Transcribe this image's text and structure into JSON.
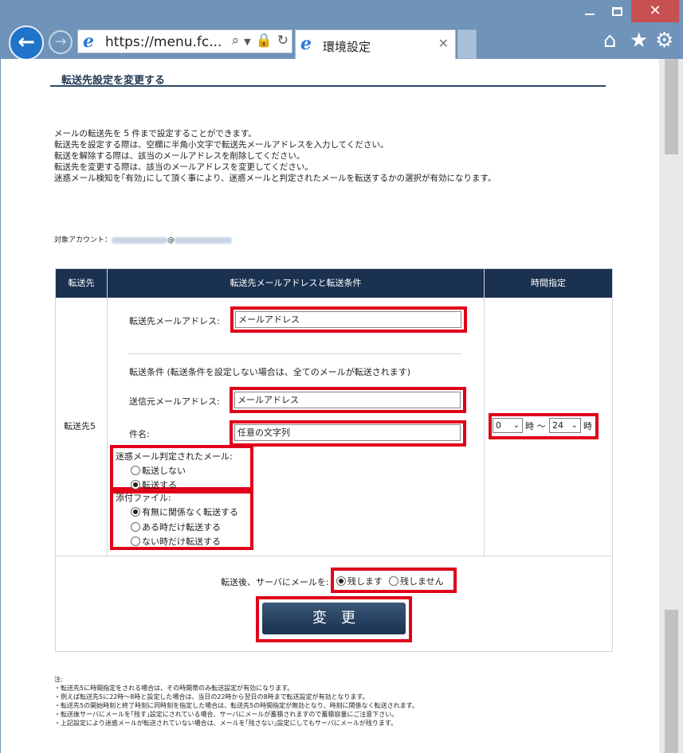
{
  "browser": {
    "url": "https://menu.fc...",
    "tab_title": "環境設定",
    "window_controls": [
      "minimize",
      "maximize",
      "close"
    ],
    "icons": [
      "back-icon",
      "forward-icon",
      "ie-logo-icon",
      "search-icon",
      "dropdown-icon",
      "lock-icon",
      "refresh-icon",
      "close-tab-icon",
      "home-icon",
      "favorites-star-icon",
      "settings-gear-icon"
    ]
  },
  "page": {
    "title": "転送先設定を変更する",
    "intro": [
      "メールの転送先を 5 件まで設定することができます。",
      "転送先を設定する際は、空欄に半角小文字で転送先メールアドレスを入力してください。",
      "転送を解除する際は、該当のメールアドレスを削除してください。",
      "転送先を変更する際は、該当のメールアドレスを変更してください。",
      "迷惑メール検知を｢有効｣にして頂く事により、迷惑メールと判定されたメールを転送するかの選択が有効になります。"
    ],
    "account_label": "対象アカウント："
  },
  "table": {
    "headers": [
      "転送先",
      "転送先メールアドレスと転送条件",
      "時間指定"
    ],
    "row_label": "転送先5",
    "forward_address_label": "転送先メールアドレス:",
    "forward_address_value": "メールアドレス",
    "conditions_label": "転送条件 (転送条件を設定しない場合は、全てのメールが転送されます)",
    "sender_label": "送信元メールアドレス:",
    "sender_value": "メールアドレス",
    "subject_label": "件名:",
    "subject_value": "任意の文字列",
    "spam_label": "迷惑メール判定されたメール:",
    "spam_options": [
      "転送しない",
      "転送する"
    ],
    "spam_selected": 1,
    "attach_label": "添付ファイル:",
    "attach_options": [
      "有無に関係なく転送する",
      "ある時だけ転送する",
      "ない時だけ転送する"
    ],
    "attach_selected": 0,
    "time_from": "0",
    "time_sep1": "時 〜",
    "time_to": "24",
    "time_sep2": "時",
    "keep_label": "転送後、サーバにメールを:",
    "keep_options": [
      "残します",
      "残しません"
    ],
    "keep_selected": 0,
    "submit_label": "変更"
  },
  "notes": [
    "注:",
    "・転送先5に時間指定をされる場合は、その時間帯のみ転送設定が有効になります。",
    "・例えば転送先5に22時〜8時と設定した場合は、当日の22時から翌日の8時まで転送設定が有効となります。",
    "・転送先5の開始時刻と終了時刻に同時刻を指定した場合は、転送先5の時間指定が無効となり、時刻に関係なく転送されます。",
    "・転送後サーバにメールを｢残す｣設定にされている場合、サーバにメールが蓄積されますので蓄積容量にご注意下さい。",
    "・上記設定により迷惑メールが転送されていない場合は、メールを｢残さない｣設定にしてもサーバにメールが残ります。"
  ],
  "colors": {
    "chrome": "#6f93b9",
    "header": "#1b3150",
    "highlight": "#e0001a"
  }
}
